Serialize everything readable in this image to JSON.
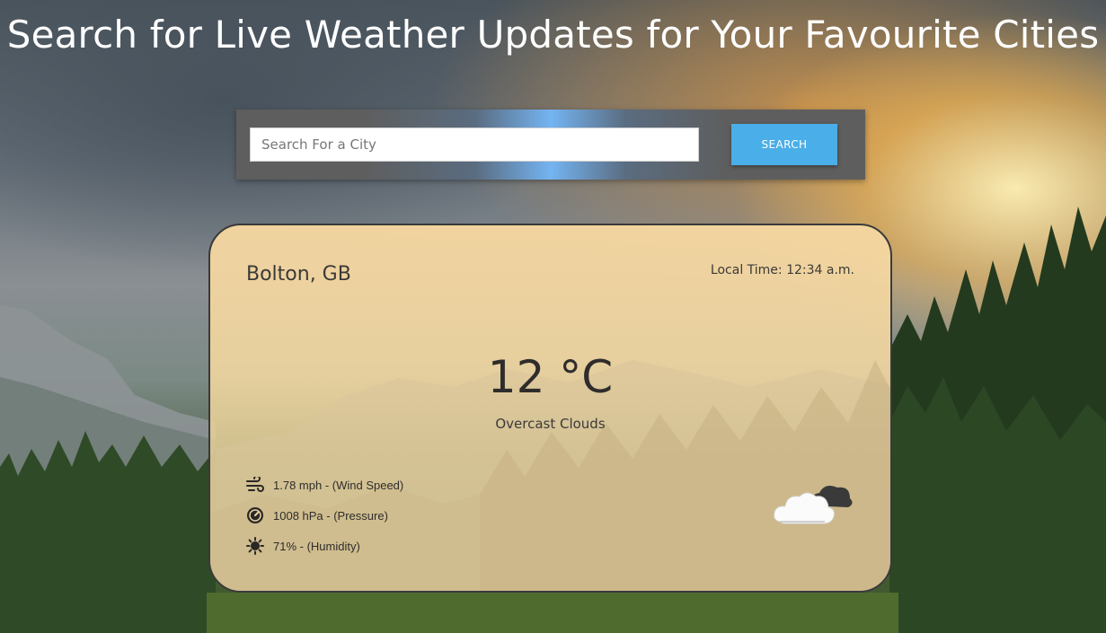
{
  "header": {
    "title": "Search for Live Weather Updates for Your Favourite Cities"
  },
  "search": {
    "placeholder": "Search For a City",
    "value": "",
    "button_label": "SEARCH"
  },
  "weather": {
    "city": "Bolton, GB",
    "local_time": "Local Time: 12:34 a.m.",
    "temperature": "12 °C",
    "condition": "Overcast Clouds",
    "stats": [
      {
        "icon": "wind-icon",
        "text": "1.78 mph - (Wind Speed)"
      },
      {
        "icon": "pressure-gauge-icon",
        "text": "1008 hPa - (Pressure)"
      },
      {
        "icon": "humidity-sun-icon",
        "text": "71% - (Humidity)"
      }
    ],
    "condition_icon": "overcast-clouds-icon"
  },
  "colors": {
    "search_button": "#4aaee8",
    "search_bar": "#5e5e5e",
    "search_highlight": "#74b4f2",
    "card_bg": "#f4d6a0",
    "text_dark": "#2f2d2b"
  }
}
